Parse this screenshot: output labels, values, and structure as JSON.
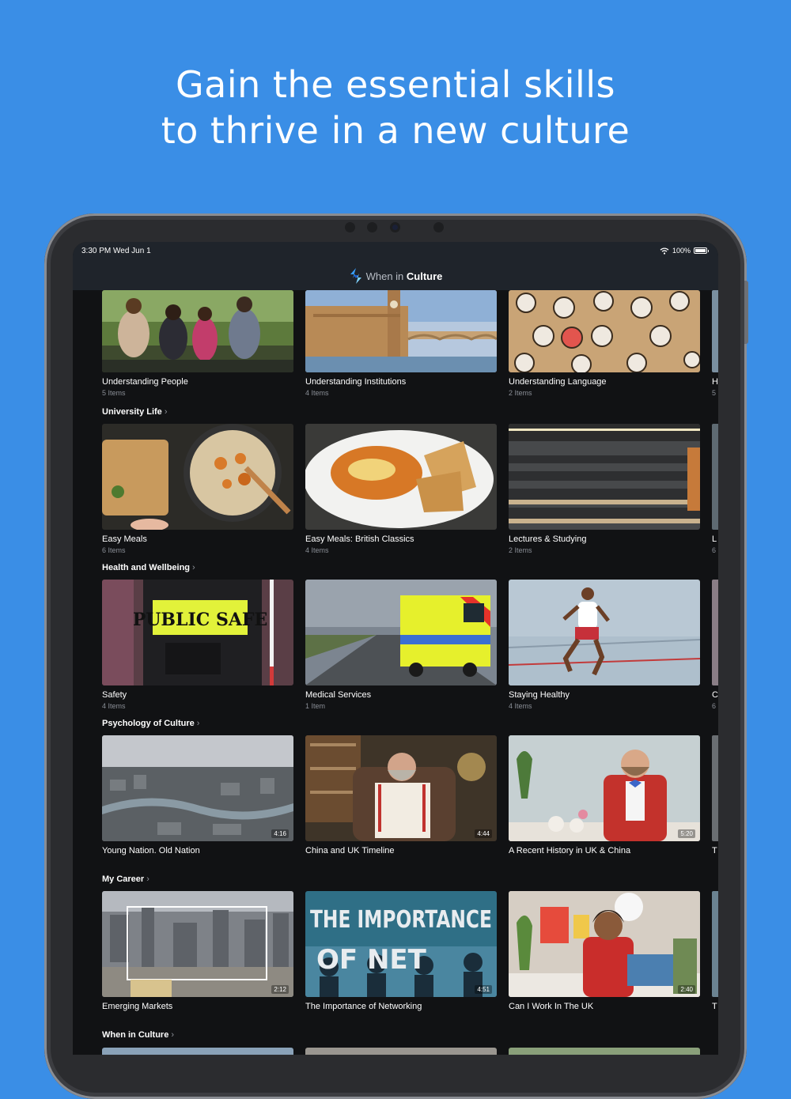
{
  "headline": {
    "line1": "Gain the essential skills",
    "line2": "to thrive in a new culture"
  },
  "status_bar": {
    "time": "3:30 PM  Wed Jun 1",
    "battery": "100%"
  },
  "app": {
    "logo_light": "When in ",
    "logo_bold": "Culture"
  },
  "top_row": [
    {
      "title": "Understanding People",
      "subtitle": "5 Items"
    },
    {
      "title": "Understanding Institutions",
      "subtitle": "4 Items"
    },
    {
      "title": "Understanding Language",
      "subtitle": "2 Items"
    }
  ],
  "top_row_peek": {
    "title": "H",
    "subtitle": "5"
  },
  "sections": [
    {
      "title": "University Life",
      "cards": [
        {
          "title": "Easy Meals",
          "subtitle": "6 Items"
        },
        {
          "title": "Easy Meals: British Classics",
          "subtitle": "4 Items"
        },
        {
          "title": "Lectures & Studying",
          "subtitle": "2 Items"
        }
      ],
      "peek": {
        "title": "L",
        "subtitle": "6"
      }
    },
    {
      "title": "Health and Wellbeing",
      "cards": [
        {
          "title": "Safety",
          "subtitle": "4 Items",
          "thumb_text": "PUBLIC SAFE"
        },
        {
          "title": "Medical Services",
          "subtitle": "1 Item"
        },
        {
          "title": "Staying Healthy",
          "subtitle": "4 Items"
        }
      ],
      "peek": {
        "title": "C",
        "subtitle": "6"
      }
    },
    {
      "title": "Psychology of Culture",
      "cards": [
        {
          "title": "Young Nation. Old Nation",
          "duration": "4:16"
        },
        {
          "title": "China and UK Timeline",
          "duration": "4:44"
        },
        {
          "title": "A Recent History in UK & China",
          "duration": "5:20"
        }
      ],
      "peek": {
        "title": "T"
      }
    },
    {
      "title": "My Career",
      "cards": [
        {
          "title": "Emerging Markets",
          "duration": "2:12"
        },
        {
          "title": "The Importance of Networking",
          "duration": "4:51",
          "thumb_text_1": "THE IMPORTANCE",
          "thumb_text_2": "OF NET"
        },
        {
          "title": "Can I Work In The UK",
          "duration": "2:40"
        }
      ],
      "peek": {
        "title": "T"
      }
    },
    {
      "title": "When in Culture",
      "cards": []
    }
  ]
}
